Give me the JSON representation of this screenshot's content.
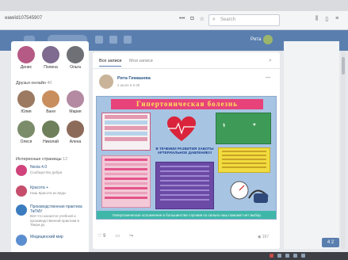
{
  "browser": {
    "url": "иам/id107545907",
    "search_placeholder": "Search"
  },
  "vk_header": {
    "user_name": "Рита"
  },
  "left": {
    "friends": [
      {
        "name": "Денис",
        "color": "#b55a84"
      },
      {
        "name": "Полина",
        "color": "#7e6b8f"
      },
      {
        "name": "Ольга",
        "color": "#6f7075"
      }
    ],
    "online_friends_title": "Друзья онлайн",
    "online_friends_count": "40",
    "online_friends": [
      {
        "name": "Юлия",
        "color": "#9c7a62"
      },
      {
        "name": "Ваня",
        "color": "#c98e5d"
      },
      {
        "name": "Мария",
        "color": "#b48aa2"
      },
      {
        "name": "Олеся",
        "color": "#7b8c6a"
      },
      {
        "name": "Николай",
        "color": "#6d7f5b"
      },
      {
        "name": "Алена",
        "color": "#8d6b5b"
      }
    ],
    "pages_title": "Интересные страницы",
    "pages_count": "12",
    "pages": [
      {
        "title": "Nexia 4.0",
        "subtitle": "Сообщество добра",
        "color": "#d1447b"
      },
      {
        "title": "Красота +",
        "subtitle": "Наш Красота из ведь!",
        "color": "#c64e6c"
      },
      {
        "title": "Производственная практика ТвГМУ",
        "subtitle": "Всё что касается учебной и производственной практики в Твери.ру",
        "color": "#3b7bbf"
      },
      {
        "title": "Медицинский мир",
        "subtitle": "",
        "color": "#5b8ed1"
      }
    ]
  },
  "feed": {
    "tab_all": "Все записи",
    "tab_mine": "Мои записи",
    "post": {
      "author": "Рита Гимашева",
      "time": "2 июля в 6:38",
      "poster_title": "Гипертоническая болезнь",
      "poster_center_caption": "В ТЕЧЕНИИ РАЗВИТИЯ ЗАБОТЫ АРТЕРИАЛЬНОЕ ДАВЛЕНИЕ!!!",
      "poster_footer": "Гипертоническое осложнение в большинстве случаев по сильно наш поможет нет выбор.",
      "likes": "9",
      "comments": "",
      "views": "167"
    }
  },
  "badge": "4 2",
  "colors": {
    "vk_header": "#5a7faf",
    "accent": "#2a5885",
    "poster_title_bg": "#e7427a",
    "poster_title_text": "#ffe65a"
  }
}
